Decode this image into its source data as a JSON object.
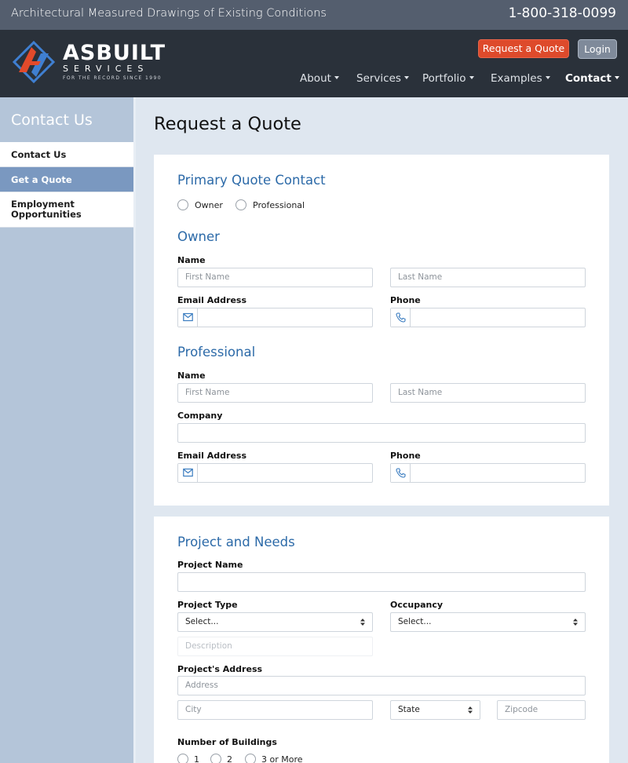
{
  "topbar": {
    "tagline": "Architectural Measured Drawings of Existing Conditions",
    "phone": "1-800-318-0099"
  },
  "header": {
    "brand": "ASBUILT",
    "brand_sub": "SERVICES",
    "brand_tag": "FOR THE RECORD SINCE 1990",
    "request_quote": "Request a Quote",
    "login": "Login",
    "nav": [
      "About",
      "Services",
      "Portfolio",
      "Examples",
      "Contact"
    ],
    "accent_color": "#de4a2b"
  },
  "sidebar": {
    "title": "Contact Us",
    "items": [
      {
        "label": "Contact Us",
        "active": false
      },
      {
        "label": "Get a Quote",
        "active": true
      },
      {
        "label": "Employment Opportunities",
        "active": false
      }
    ]
  },
  "main": {
    "title": "Request a Quote",
    "primary": {
      "heading": "Primary Quote Contact",
      "options": [
        "Owner",
        "Professional"
      ]
    },
    "owner": {
      "heading": "Owner",
      "name_label": "Name",
      "first_ph": "First Name",
      "last_ph": "Last Name",
      "email_label": "Email Address",
      "phone_label": "Phone"
    },
    "professional": {
      "heading": "Professional",
      "name_label": "Name",
      "first_ph": "First Name",
      "last_ph": "Last Name",
      "company_label": "Company",
      "email_label": "Email Address",
      "phone_label": "Phone"
    },
    "project": {
      "heading": "Project and Needs",
      "name_label": "Project Name",
      "type_label": "Project Type",
      "type_value": "Select...",
      "occupancy_label": "Occupancy",
      "occupancy_value": "Select...",
      "description_ph": "Description",
      "address_label": "Project's Address",
      "address_ph": "Address",
      "city_ph": "City",
      "state_value": "State",
      "zip_ph": "Zipcode",
      "buildings_label": "Number of Buildings",
      "buildings_options": [
        "1",
        "2",
        "3 or More"
      ]
    }
  }
}
